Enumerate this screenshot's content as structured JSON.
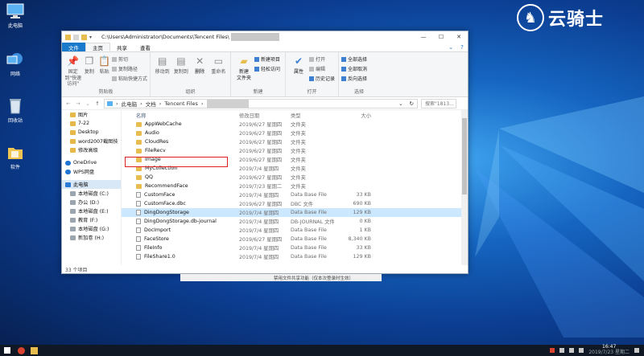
{
  "desktop": {
    "icons": [
      {
        "label": "此电脑",
        "icon": "computer-icon"
      },
      {
        "label": "网络",
        "icon": "network-icon"
      },
      {
        "label": "回收站",
        "icon": "recycle-bin-icon"
      },
      {
        "label": "软件",
        "icon": "folder-icon"
      }
    ],
    "brand": "云骑士"
  },
  "window": {
    "title_path": "C:\\Users\\Administrator\\Documents\\Tencent Files\\",
    "tabs": [
      "文件",
      "主页",
      "共享",
      "查看"
    ],
    "active_tab": "主页",
    "ribbon": {
      "clipboard": {
        "label": "剪贴板",
        "pin": "固定到\"快速访问\"",
        "copy": "复制",
        "paste": "粘贴",
        "cut": "剪切",
        "copy_path": "复制路径",
        "paste_shortcut": "粘贴快捷方式"
      },
      "organize": {
        "label": "组织",
        "move_to": "移动到",
        "copy_to": "复制到",
        "delete": "删除",
        "rename": "重命名"
      },
      "new": {
        "label": "新建",
        "new_folder": "新建\n文件夹",
        "new_item": "新建项目",
        "easy_access": "轻松访问"
      },
      "open": {
        "label": "打开",
        "properties": "属性",
        "open": "打开",
        "edit": "编辑",
        "history": "历史记录"
      },
      "select": {
        "label": "选择",
        "select_all": "全部选择",
        "select_none": "全部取消",
        "invert": "反向选择"
      }
    },
    "address": {
      "crumbs": [
        "此电脑",
        "文档",
        "Tencent Files"
      ],
      "search_placeholder": "搜索\"1813..."
    },
    "nav_pane": [
      {
        "label": "图片",
        "kind": "folder"
      },
      {
        "label": "7-22",
        "kind": "folder"
      },
      {
        "label": "Desktop",
        "kind": "folder"
      },
      {
        "label": "word2007截图技",
        "kind": "folder"
      },
      {
        "label": "修改高级",
        "kind": "folder"
      },
      {
        "label": "OneDrive",
        "kind": "cloud"
      },
      {
        "label": "WPS网盘",
        "kind": "cloud"
      },
      {
        "label": "此电脑",
        "kind": "pc"
      },
      {
        "label": "本地磁盘 (C:)",
        "kind": "drive"
      },
      {
        "label": "办公 (D:)",
        "kind": "drive"
      },
      {
        "label": "本地磁盘 (E:)",
        "kind": "drive"
      },
      {
        "label": "教育 (F:)",
        "kind": "drive"
      },
      {
        "label": "本地磁盘 (G:)",
        "kind": "drive"
      },
      {
        "label": "新加卷 (H:)",
        "kind": "drive"
      }
    ],
    "columns": {
      "name": "名称",
      "date": "修改日期",
      "type": "类型",
      "size": "大小"
    },
    "files": [
      {
        "name": "AppWebCache",
        "date": "2019/6/27 星期四",
        "type": "文件夹",
        "size": "",
        "kind": "folder"
      },
      {
        "name": "Audio",
        "date": "2019/6/27 星期四",
        "type": "文件夹",
        "size": "",
        "kind": "folder"
      },
      {
        "name": "CloudRes",
        "date": "2019/6/27 星期四",
        "type": "文件夹",
        "size": "",
        "kind": "folder"
      },
      {
        "name": "FileRecv",
        "date": "2019/6/27 星期四",
        "type": "文件夹",
        "size": "",
        "kind": "folder"
      },
      {
        "name": "Image",
        "date": "2019/6/27 星期四",
        "type": "文件夹",
        "size": "",
        "kind": "folder"
      },
      {
        "name": "MyCollection",
        "date": "2019/7/4 星期四",
        "type": "文件夹",
        "size": "",
        "kind": "folder"
      },
      {
        "name": "QQ",
        "date": "2019/6/27 星期四",
        "type": "文件夹",
        "size": "",
        "kind": "folder"
      },
      {
        "name": "RecommendFace",
        "date": "2019/7/23 星期二",
        "type": "文件夹",
        "size": "",
        "kind": "folder"
      },
      {
        "name": "CustomFace",
        "date": "2019/7/4 星期四",
        "type": "Data Base File",
        "size": "33 KB",
        "kind": "file"
      },
      {
        "name": "CustomFace.dbc",
        "date": "2019/6/27 星期四",
        "type": "DBC 文件",
        "size": "690 KB",
        "kind": "file"
      },
      {
        "name": "DingDongStorage",
        "date": "2019/7/4 星期四",
        "type": "Data Base File",
        "size": "129 KB",
        "kind": "file"
      },
      {
        "name": "DingDongStorage.db-journal",
        "date": "2019/7/4 星期四",
        "type": "DB-JOURNAL 文件",
        "size": "0 KB",
        "kind": "file"
      },
      {
        "name": "DocImport",
        "date": "2019/7/4 星期四",
        "type": "Data Base File",
        "size": "1 KB",
        "kind": "file"
      },
      {
        "name": "FaceStore",
        "date": "2019/6/27 星期四",
        "type": "Data Base File",
        "size": "8,340 KB",
        "kind": "file"
      },
      {
        "name": "FileInfo",
        "date": "2019/7/4 星期四",
        "type": "Data Base File",
        "size": "33 KB",
        "kind": "file"
      },
      {
        "name": "FileShare1.0",
        "date": "2019/7/4 星期四",
        "type": "Data Base File",
        "size": "129 KB",
        "kind": "file"
      }
    ],
    "selected_file": "DingDongStorage",
    "highlighted_file": "Image",
    "status": "33 个项目"
  },
  "background_window_text": "禁用文件共享功能（仅本次登录时生效）",
  "taskbar": {
    "time": "16:47",
    "date": "2019/7/23 星期二"
  }
}
